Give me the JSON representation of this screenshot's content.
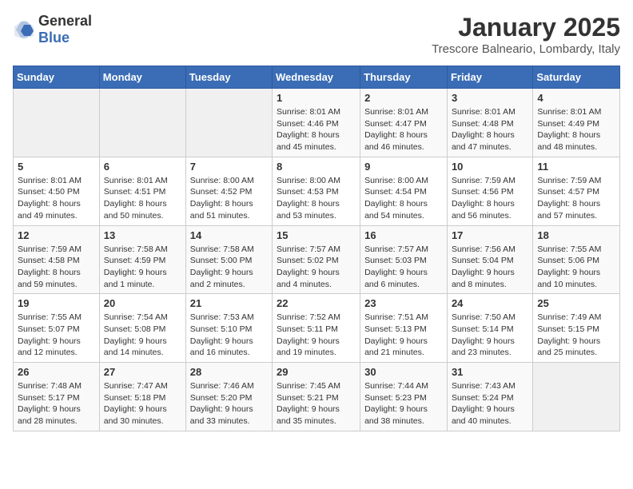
{
  "header": {
    "logo_general": "General",
    "logo_blue": "Blue",
    "title": "January 2025",
    "subtitle": "Trescore Balneario, Lombardy, Italy"
  },
  "columns": [
    "Sunday",
    "Monday",
    "Tuesday",
    "Wednesday",
    "Thursday",
    "Friday",
    "Saturday"
  ],
  "weeks": [
    [
      {
        "day": "",
        "info": ""
      },
      {
        "day": "",
        "info": ""
      },
      {
        "day": "",
        "info": ""
      },
      {
        "day": "1",
        "info": "Sunrise: 8:01 AM\nSunset: 4:46 PM\nDaylight: 8 hours\nand 45 minutes."
      },
      {
        "day": "2",
        "info": "Sunrise: 8:01 AM\nSunset: 4:47 PM\nDaylight: 8 hours\nand 46 minutes."
      },
      {
        "day": "3",
        "info": "Sunrise: 8:01 AM\nSunset: 4:48 PM\nDaylight: 8 hours\nand 47 minutes."
      },
      {
        "day": "4",
        "info": "Sunrise: 8:01 AM\nSunset: 4:49 PM\nDaylight: 8 hours\nand 48 minutes."
      }
    ],
    [
      {
        "day": "5",
        "info": "Sunrise: 8:01 AM\nSunset: 4:50 PM\nDaylight: 8 hours\nand 49 minutes."
      },
      {
        "day": "6",
        "info": "Sunrise: 8:01 AM\nSunset: 4:51 PM\nDaylight: 8 hours\nand 50 minutes."
      },
      {
        "day": "7",
        "info": "Sunrise: 8:00 AM\nSunset: 4:52 PM\nDaylight: 8 hours\nand 51 minutes."
      },
      {
        "day": "8",
        "info": "Sunrise: 8:00 AM\nSunset: 4:53 PM\nDaylight: 8 hours\nand 53 minutes."
      },
      {
        "day": "9",
        "info": "Sunrise: 8:00 AM\nSunset: 4:54 PM\nDaylight: 8 hours\nand 54 minutes."
      },
      {
        "day": "10",
        "info": "Sunrise: 7:59 AM\nSunset: 4:56 PM\nDaylight: 8 hours\nand 56 minutes."
      },
      {
        "day": "11",
        "info": "Sunrise: 7:59 AM\nSunset: 4:57 PM\nDaylight: 8 hours\nand 57 minutes."
      }
    ],
    [
      {
        "day": "12",
        "info": "Sunrise: 7:59 AM\nSunset: 4:58 PM\nDaylight: 8 hours\nand 59 minutes."
      },
      {
        "day": "13",
        "info": "Sunrise: 7:58 AM\nSunset: 4:59 PM\nDaylight: 9 hours\nand 1 minute."
      },
      {
        "day": "14",
        "info": "Sunrise: 7:58 AM\nSunset: 5:00 PM\nDaylight: 9 hours\nand 2 minutes."
      },
      {
        "day": "15",
        "info": "Sunrise: 7:57 AM\nSunset: 5:02 PM\nDaylight: 9 hours\nand 4 minutes."
      },
      {
        "day": "16",
        "info": "Sunrise: 7:57 AM\nSunset: 5:03 PM\nDaylight: 9 hours\nand 6 minutes."
      },
      {
        "day": "17",
        "info": "Sunrise: 7:56 AM\nSunset: 5:04 PM\nDaylight: 9 hours\nand 8 minutes."
      },
      {
        "day": "18",
        "info": "Sunrise: 7:55 AM\nSunset: 5:06 PM\nDaylight: 9 hours\nand 10 minutes."
      }
    ],
    [
      {
        "day": "19",
        "info": "Sunrise: 7:55 AM\nSunset: 5:07 PM\nDaylight: 9 hours\nand 12 minutes."
      },
      {
        "day": "20",
        "info": "Sunrise: 7:54 AM\nSunset: 5:08 PM\nDaylight: 9 hours\nand 14 minutes."
      },
      {
        "day": "21",
        "info": "Sunrise: 7:53 AM\nSunset: 5:10 PM\nDaylight: 9 hours\nand 16 minutes."
      },
      {
        "day": "22",
        "info": "Sunrise: 7:52 AM\nSunset: 5:11 PM\nDaylight: 9 hours\nand 19 minutes."
      },
      {
        "day": "23",
        "info": "Sunrise: 7:51 AM\nSunset: 5:13 PM\nDaylight: 9 hours\nand 21 minutes."
      },
      {
        "day": "24",
        "info": "Sunrise: 7:50 AM\nSunset: 5:14 PM\nDaylight: 9 hours\nand 23 minutes."
      },
      {
        "day": "25",
        "info": "Sunrise: 7:49 AM\nSunset: 5:15 PM\nDaylight: 9 hours\nand 25 minutes."
      }
    ],
    [
      {
        "day": "26",
        "info": "Sunrise: 7:48 AM\nSunset: 5:17 PM\nDaylight: 9 hours\nand 28 minutes."
      },
      {
        "day": "27",
        "info": "Sunrise: 7:47 AM\nSunset: 5:18 PM\nDaylight: 9 hours\nand 30 minutes."
      },
      {
        "day": "28",
        "info": "Sunrise: 7:46 AM\nSunset: 5:20 PM\nDaylight: 9 hours\nand 33 minutes."
      },
      {
        "day": "29",
        "info": "Sunrise: 7:45 AM\nSunset: 5:21 PM\nDaylight: 9 hours\nand 35 minutes."
      },
      {
        "day": "30",
        "info": "Sunrise: 7:44 AM\nSunset: 5:23 PM\nDaylight: 9 hours\nand 38 minutes."
      },
      {
        "day": "31",
        "info": "Sunrise: 7:43 AM\nSunset: 5:24 PM\nDaylight: 9 hours\nand 40 minutes."
      },
      {
        "day": "",
        "info": ""
      }
    ]
  ]
}
